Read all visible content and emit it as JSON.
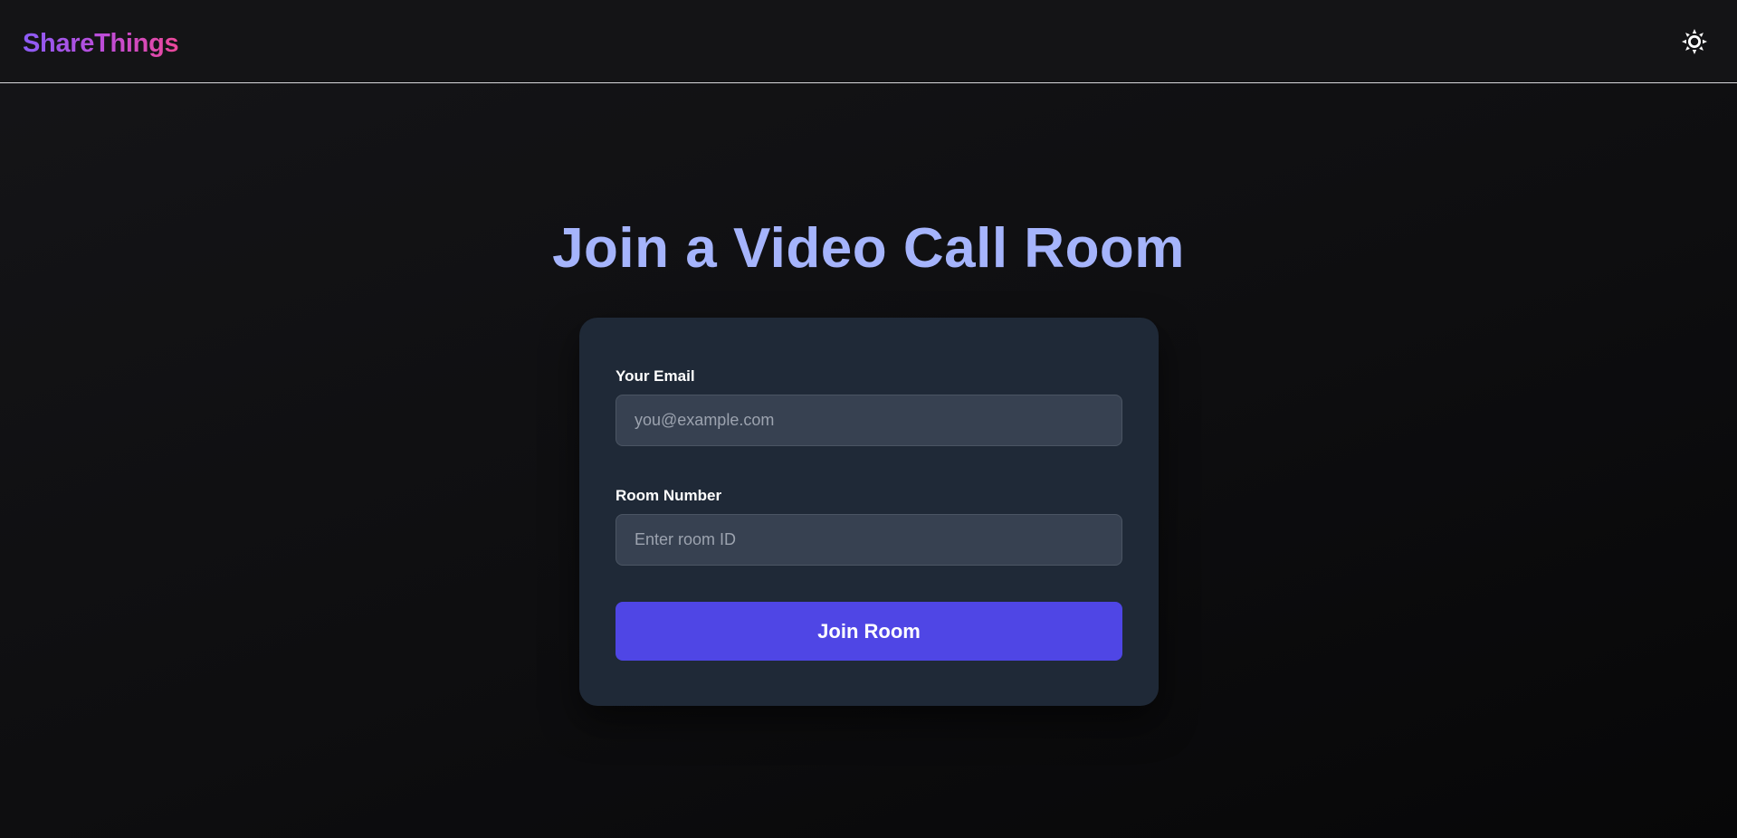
{
  "header": {
    "logo_text": "ShareThings",
    "theme_toggle_icon": "sun-icon"
  },
  "main": {
    "title": "Join a Video Call Room"
  },
  "form": {
    "email": {
      "label": "Your Email",
      "placeholder": "you@example.com",
      "value": ""
    },
    "room": {
      "label": "Room Number",
      "placeholder": "Enter room ID",
      "value": ""
    },
    "submit_label": "Join Room"
  },
  "colors": {
    "background": "#0e0e10",
    "title": "#a5b4fc",
    "card": "#1f2937",
    "input": "#374151",
    "button": "#4f46e5",
    "logo_gradient_start": "#8b5cf6",
    "logo_gradient_end": "#ec4899"
  }
}
